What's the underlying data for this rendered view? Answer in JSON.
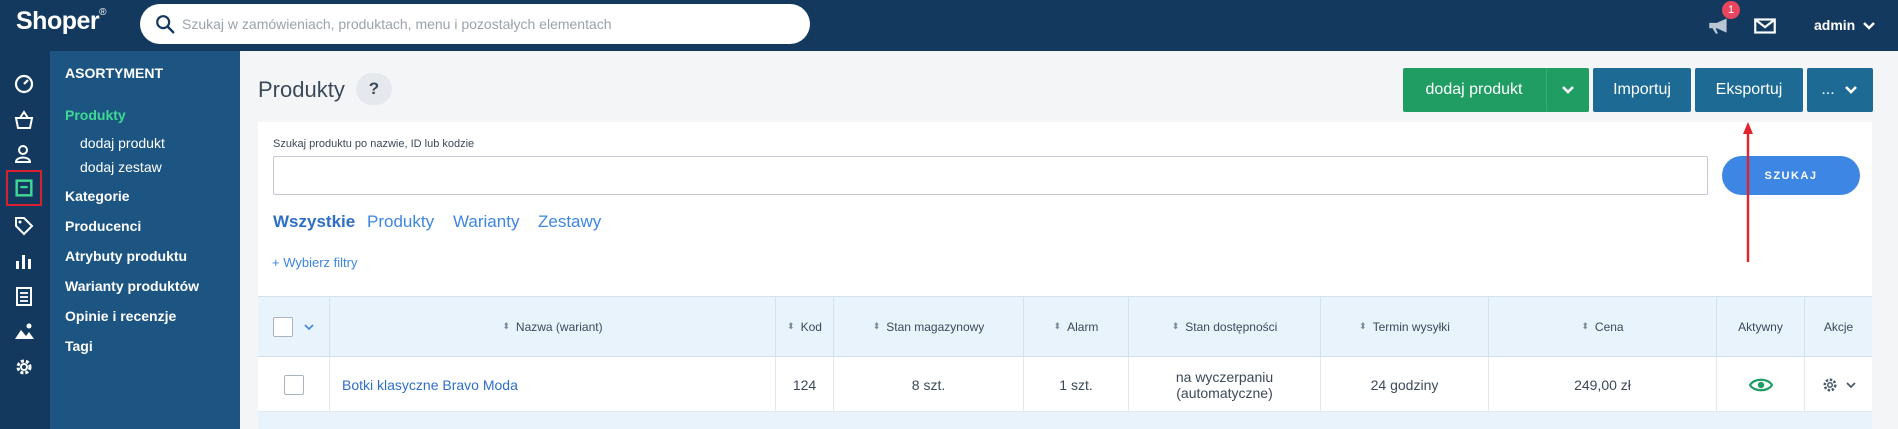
{
  "topbar": {
    "logo": "Shoper",
    "logo_mark": "®",
    "search_placeholder": "Szukaj w zamówieniach, produktach, menu i pozostałych elementach",
    "notifications_count": "1",
    "user": "admin"
  },
  "iconbar": {
    "items": [
      "dashboard-icon",
      "basket-icon",
      "users-icon",
      "box-icon",
      "tag-icon",
      "chart-icon",
      "pages-icon",
      "image-icon",
      "gear-icon"
    ],
    "active_index": 3
  },
  "subnav": {
    "header": "ASORTYMENT",
    "items": [
      {
        "label": "Produkty",
        "active": true
      },
      {
        "label": "dodaj produkt",
        "sub": true
      },
      {
        "label": "dodaj zestaw",
        "sub": true
      },
      {
        "label": "Kategorie"
      },
      {
        "label": "Producenci"
      },
      {
        "label": "Atrybuty produktu"
      },
      {
        "label": "Warianty produktów"
      },
      {
        "label": "Opinie i recenzje"
      },
      {
        "label": "Tagi"
      }
    ]
  },
  "main": {
    "title": "Produkty",
    "help": "?",
    "buttons": {
      "add_product": "dodaj produkt",
      "import": "Importuj",
      "export": "Eksportuj",
      "more": "..."
    },
    "search": {
      "label": "Szukaj produktu po nazwie, ID lub kodzie",
      "value": "",
      "button": "SZUKAJ"
    },
    "tabs": [
      "Wszystkie",
      "Produkty",
      "Warianty",
      "Zestawy"
    ],
    "active_tab": 0,
    "filters_link": "+ Wybierz filtry"
  },
  "table": {
    "columns": [
      "Nazwa (wariant)",
      "Kod",
      "Stan magazynowy",
      "Alarm",
      "Stan dostępności",
      "Termin wysyłki",
      "Cena",
      "Aktywny",
      "Akcje"
    ],
    "rows": [
      {
        "name": "Botki klasyczne Bravo Moda",
        "code": "124",
        "stock": "8 szt.",
        "alarm": "1 szt.",
        "availability_line1": "na wyczerpaniu",
        "availability_line2": "(automatyczne)",
        "shipping": "24 godziny",
        "price": "249,00 zł"
      }
    ]
  },
  "colors": {
    "topbar": "#133a5e",
    "subnav": "#1d5582",
    "accent_green": "#1f9d63",
    "active_nav": "#3fd995",
    "primary_blue": "#1d6b94",
    "search_button": "#3d86e3",
    "annotation_red": "#d8202f"
  }
}
